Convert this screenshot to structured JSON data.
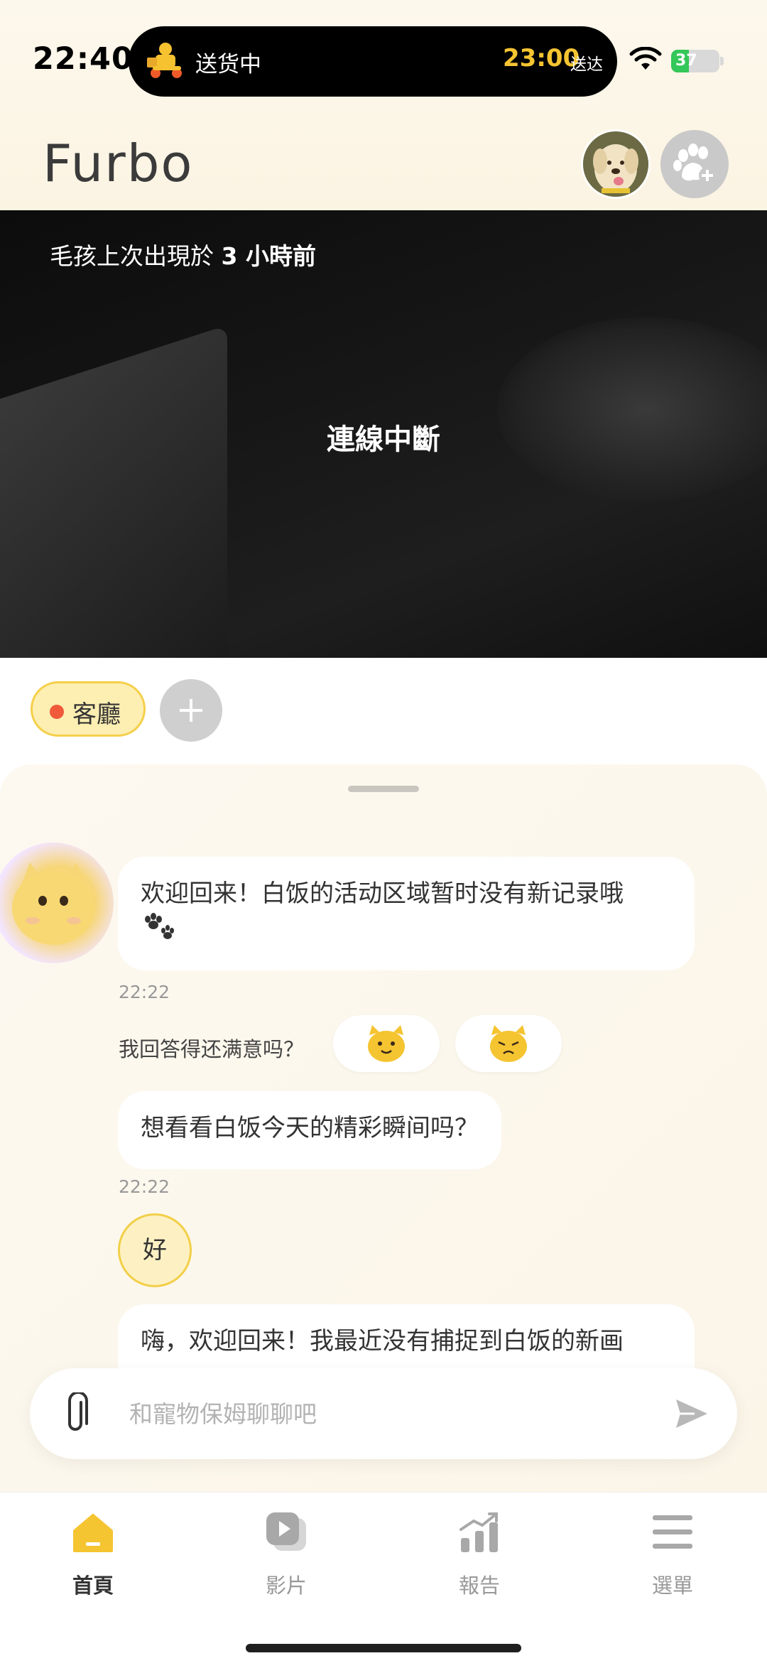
{
  "status_bar": {
    "time": "22:40",
    "delivery_label": "送货中",
    "delivery_time": "23:00",
    "delivery_suffix": "送达",
    "battery": "37",
    "battery_level": 0.37
  },
  "header": {
    "logo": "Furbo"
  },
  "camera": {
    "last_seen_prefix": "毛孩上次出現於",
    "last_seen_value": "3 小時前",
    "status": "連線中斷"
  },
  "rooms": {
    "active_room": "客廳",
    "add_symbol": "+"
  },
  "chat": {
    "messages": [
      {
        "text": "欢迎回来！白饭的活动区域暂时没有新记录哦",
        "time": "22:22"
      },
      {
        "text": "想看看白饭今天的精彩瞬间吗？",
        "time": "22:22"
      },
      {
        "text": "嗨，欢迎回来！我最近没有捕捉到白饭的新画"
      }
    ],
    "rating_question": "我回答得还满意吗？",
    "user_reply": "好"
  },
  "input": {
    "placeholder": "和寵物保姆聊聊吧"
  },
  "tabs": [
    {
      "label": "首頁",
      "icon": "home-icon"
    },
    {
      "label": "影片",
      "icon": "video-icon"
    },
    {
      "label": "報告",
      "icon": "chart-icon"
    },
    {
      "label": "選單",
      "icon": "menu-icon"
    }
  ],
  "colors": {
    "accent_yellow": "#f5c431",
    "chip_bg": "#fdeeb2",
    "alert_red": "#f0593a"
  }
}
